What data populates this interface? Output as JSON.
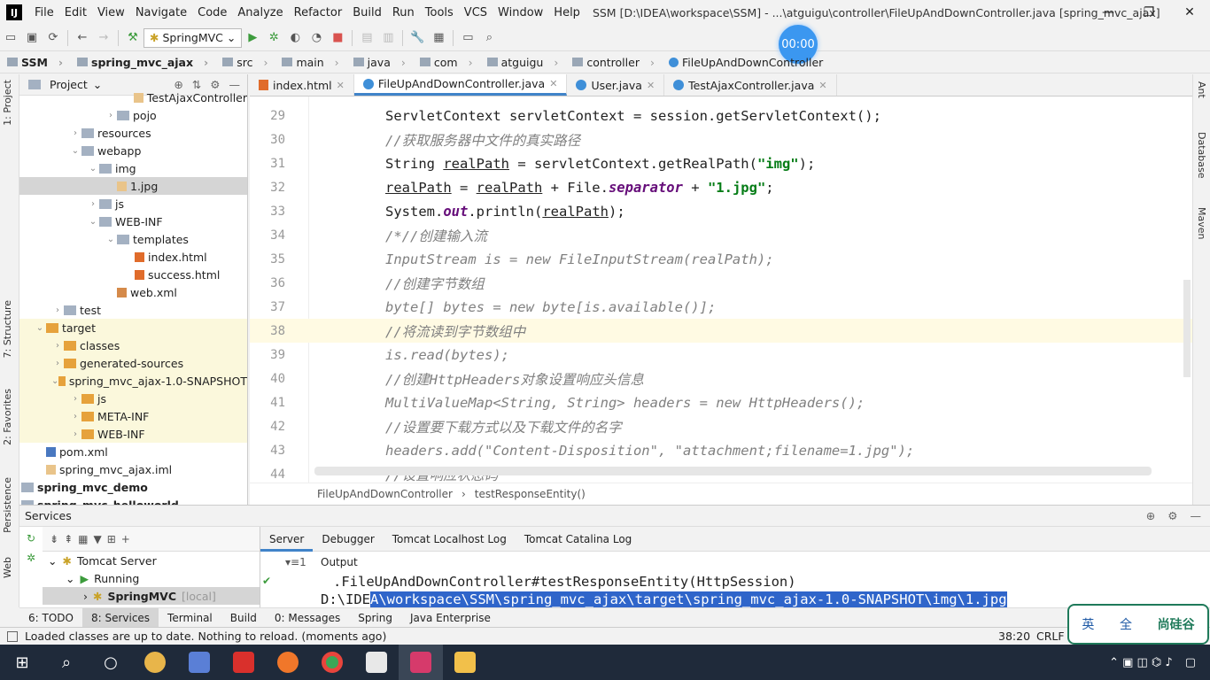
{
  "titlebar": {
    "logo": "IJ",
    "menus": [
      "File",
      "Edit",
      "View",
      "Navigate",
      "Code",
      "Analyze",
      "Refactor",
      "Build",
      "Run",
      "Tools",
      "VCS",
      "Window",
      "Help"
    ],
    "title": "SSM [D:\\IDEA\\workspace\\SSM] - ...\\atguigu\\controller\\FileUpAndDownController.java [spring_mvc_ajax]"
  },
  "toolbar": {
    "run_config": "SpringMVC"
  },
  "timer": "00:00",
  "breadcrumb": [
    "SSM",
    "spring_mvc_ajax",
    "src",
    "main",
    "java",
    "com",
    "atguigu",
    "controller",
    "FileUpAndDownController"
  ],
  "left_stripe": [
    "1: Project",
    "7: Structure",
    "2: Favorites",
    "Persistence",
    "Web"
  ],
  "right_stripe": [
    "Ant",
    "Database",
    "Maven"
  ],
  "project": {
    "title": "Project",
    "items": [
      {
        "label": "TestAjaxController",
        "depth": 5,
        "icon": "file",
        "arrow": ""
      },
      {
        "label": "pojo",
        "depth": 4,
        "icon": "folder",
        "arrow": "›"
      },
      {
        "label": "resources",
        "depth": 2,
        "icon": "folder",
        "arrow": "›"
      },
      {
        "label": "webapp",
        "depth": 2,
        "icon": "folder",
        "arrow": "⌄"
      },
      {
        "label": "img",
        "depth": 3,
        "icon": "folder",
        "arrow": "⌄"
      },
      {
        "label": "1.jpg",
        "depth": 4,
        "icon": "file",
        "arrow": "",
        "selected": true
      },
      {
        "label": "js",
        "depth": 3,
        "icon": "folder",
        "arrow": "›"
      },
      {
        "label": "WEB-INF",
        "depth": 3,
        "icon": "folder",
        "arrow": "⌄"
      },
      {
        "label": "templates",
        "depth": 4,
        "icon": "folder",
        "arrow": "⌄"
      },
      {
        "label": "index.html",
        "depth": 5,
        "icon": "html",
        "arrow": ""
      },
      {
        "label": "success.html",
        "depth": 5,
        "icon": "html",
        "arrow": ""
      },
      {
        "label": "web.xml",
        "depth": 4,
        "icon": "xml",
        "arrow": ""
      },
      {
        "label": "test",
        "depth": 1,
        "icon": "folder",
        "arrow": "›"
      },
      {
        "label": "target",
        "depth": 0,
        "icon": "ofolder",
        "arrow": "⌄",
        "target": true
      },
      {
        "label": "classes",
        "depth": 1,
        "icon": "ofolder",
        "arrow": "›",
        "target": true
      },
      {
        "label": "generated-sources",
        "depth": 1,
        "icon": "ofolder",
        "arrow": "›",
        "target": true
      },
      {
        "label": "spring_mvc_ajax-1.0-SNAPSHOT",
        "depth": 1,
        "icon": "ofolder",
        "arrow": "⌄",
        "target": true
      },
      {
        "label": "js",
        "depth": 2,
        "icon": "ofolder",
        "arrow": "›",
        "target": true
      },
      {
        "label": "META-INF",
        "depth": 2,
        "icon": "ofolder",
        "arrow": "›",
        "target": true
      },
      {
        "label": "WEB-INF",
        "depth": 2,
        "icon": "ofolder",
        "arrow": "›",
        "target": true
      },
      {
        "label": "pom.xml",
        "depth": 0,
        "icon": "pom",
        "arrow": ""
      },
      {
        "label": "spring_mvc_ajax.iml",
        "depth": 0,
        "icon": "file",
        "arrow": ""
      },
      {
        "label": "spring_mvc_demo",
        "depth": -1,
        "icon": "folder",
        "arrow": "",
        "bold": true
      },
      {
        "label": "spring_mvc_helloworld",
        "depth": -1,
        "icon": "folder",
        "arrow": "",
        "bold": true
      }
    ]
  },
  "editor": {
    "tabs": [
      {
        "label": "index.html",
        "type": "h"
      },
      {
        "label": "FileUpAndDownController.java",
        "type": "c",
        "active": true
      },
      {
        "label": "User.java",
        "type": "c"
      },
      {
        "label": "TestAjaxController.java",
        "type": "c"
      }
    ],
    "lines": [
      {
        "n": "29",
        "tokens": [
          [
            "ServletContext servletContext = session.getServletContext();",
            ""
          ]
        ]
      },
      {
        "n": "30",
        "tokens": [
          [
            "//获取服务器中文件的真实路径",
            "cm"
          ]
        ]
      },
      {
        "n": "31",
        "tokens": [
          [
            "String ",
            ""
          ],
          [
            "realPath",
            "u"
          ],
          [
            " = servletContext.getRealPath(",
            ""
          ],
          [
            "\"img\"",
            "s"
          ],
          [
            ");",
            ""
          ]
        ]
      },
      {
        "n": "32",
        "tokens": [
          [
            "realPath",
            "u"
          ],
          [
            " = ",
            ""
          ],
          [
            "realPath",
            "u"
          ],
          [
            " + File.",
            ""
          ],
          [
            "separator",
            "st"
          ],
          [
            " + ",
            ""
          ],
          [
            "\"1.jpg\"",
            "s"
          ],
          [
            ";",
            ""
          ]
        ]
      },
      {
        "n": "33",
        "tokens": [
          [
            "System.",
            ""
          ],
          [
            "out",
            "st"
          ],
          [
            ".println(",
            ""
          ],
          [
            "realPath",
            "u"
          ],
          [
            ");",
            ""
          ]
        ]
      },
      {
        "n": "34",
        "tokens": [
          [
            "/*//创建输入流",
            "cm"
          ]
        ]
      },
      {
        "n": "35",
        "tokens": [
          [
            "InputStream is = new FileInputStream(realPath);",
            "cm"
          ]
        ]
      },
      {
        "n": "36",
        "tokens": [
          [
            "//创建字节数组",
            "cm"
          ]
        ]
      },
      {
        "n": "37",
        "tokens": [
          [
            "byte[] bytes = new byte[is.available()];",
            "cm"
          ]
        ]
      },
      {
        "n": "38",
        "tokens": [
          [
            "//将流读到字节数组中",
            "cm"
          ]
        ],
        "current": true
      },
      {
        "n": "39",
        "tokens": [
          [
            "is.read(bytes);",
            "cm"
          ]
        ]
      },
      {
        "n": "40",
        "tokens": [
          [
            "//创建HttpHeaders对象设置响应头信息",
            "cm"
          ]
        ]
      },
      {
        "n": "41",
        "tokens": [
          [
            "MultiValueMap<String, String> headers = new HttpHeaders();",
            "cm"
          ]
        ]
      },
      {
        "n": "42",
        "tokens": [
          [
            "//设置要下载方式以及下载文件的名字",
            "cm"
          ]
        ]
      },
      {
        "n": "43",
        "tokens": [
          [
            "headers.add(\"Content-Disposition\", \"attachment;filename=1.jpg\");",
            "cm"
          ]
        ]
      },
      {
        "n": "44",
        "tokens": [
          [
            "//设置响应状态码",
            "cm"
          ]
        ]
      }
    ],
    "crumbs": [
      "FileUpAndDownController",
      "testResponseEntity()"
    ]
  },
  "services": {
    "title": "Services",
    "tree": [
      {
        "label": "Tomcat Server"
      },
      {
        "label": "Running"
      },
      {
        "label": "SpringMVC",
        "suffix": "[local]"
      }
    ],
    "tabs": [
      "Server",
      "Debugger",
      "Tomcat Localhost Log",
      "Tomcat Catalina Log"
    ],
    "output_label": "Output",
    "output": [
      ".FileUpAndDownController#testResponseEntity(HttpSession)"
    ],
    "output_path_prefix": "D:\\IDE",
    "output_path_sel": "A\\workspace\\SSM\\spring_mvc_ajax\\target\\spring_mvc_ajax-1.0-SNAPSHOT\\img\\1.jpg"
  },
  "bottom_tabs": [
    "6: TODO",
    "8: Services",
    "Terminal",
    "Build",
    "0: Messages",
    "Spring",
    "Java Enterprise"
  ],
  "status": {
    "message": "Loaded classes are up to date. Nothing to reload. (moments ago)",
    "position": "38:20",
    "line_sep": "CRLF"
  },
  "ime": {
    "lang": "英",
    "mode": "全",
    "brand": "尚硅谷"
  }
}
